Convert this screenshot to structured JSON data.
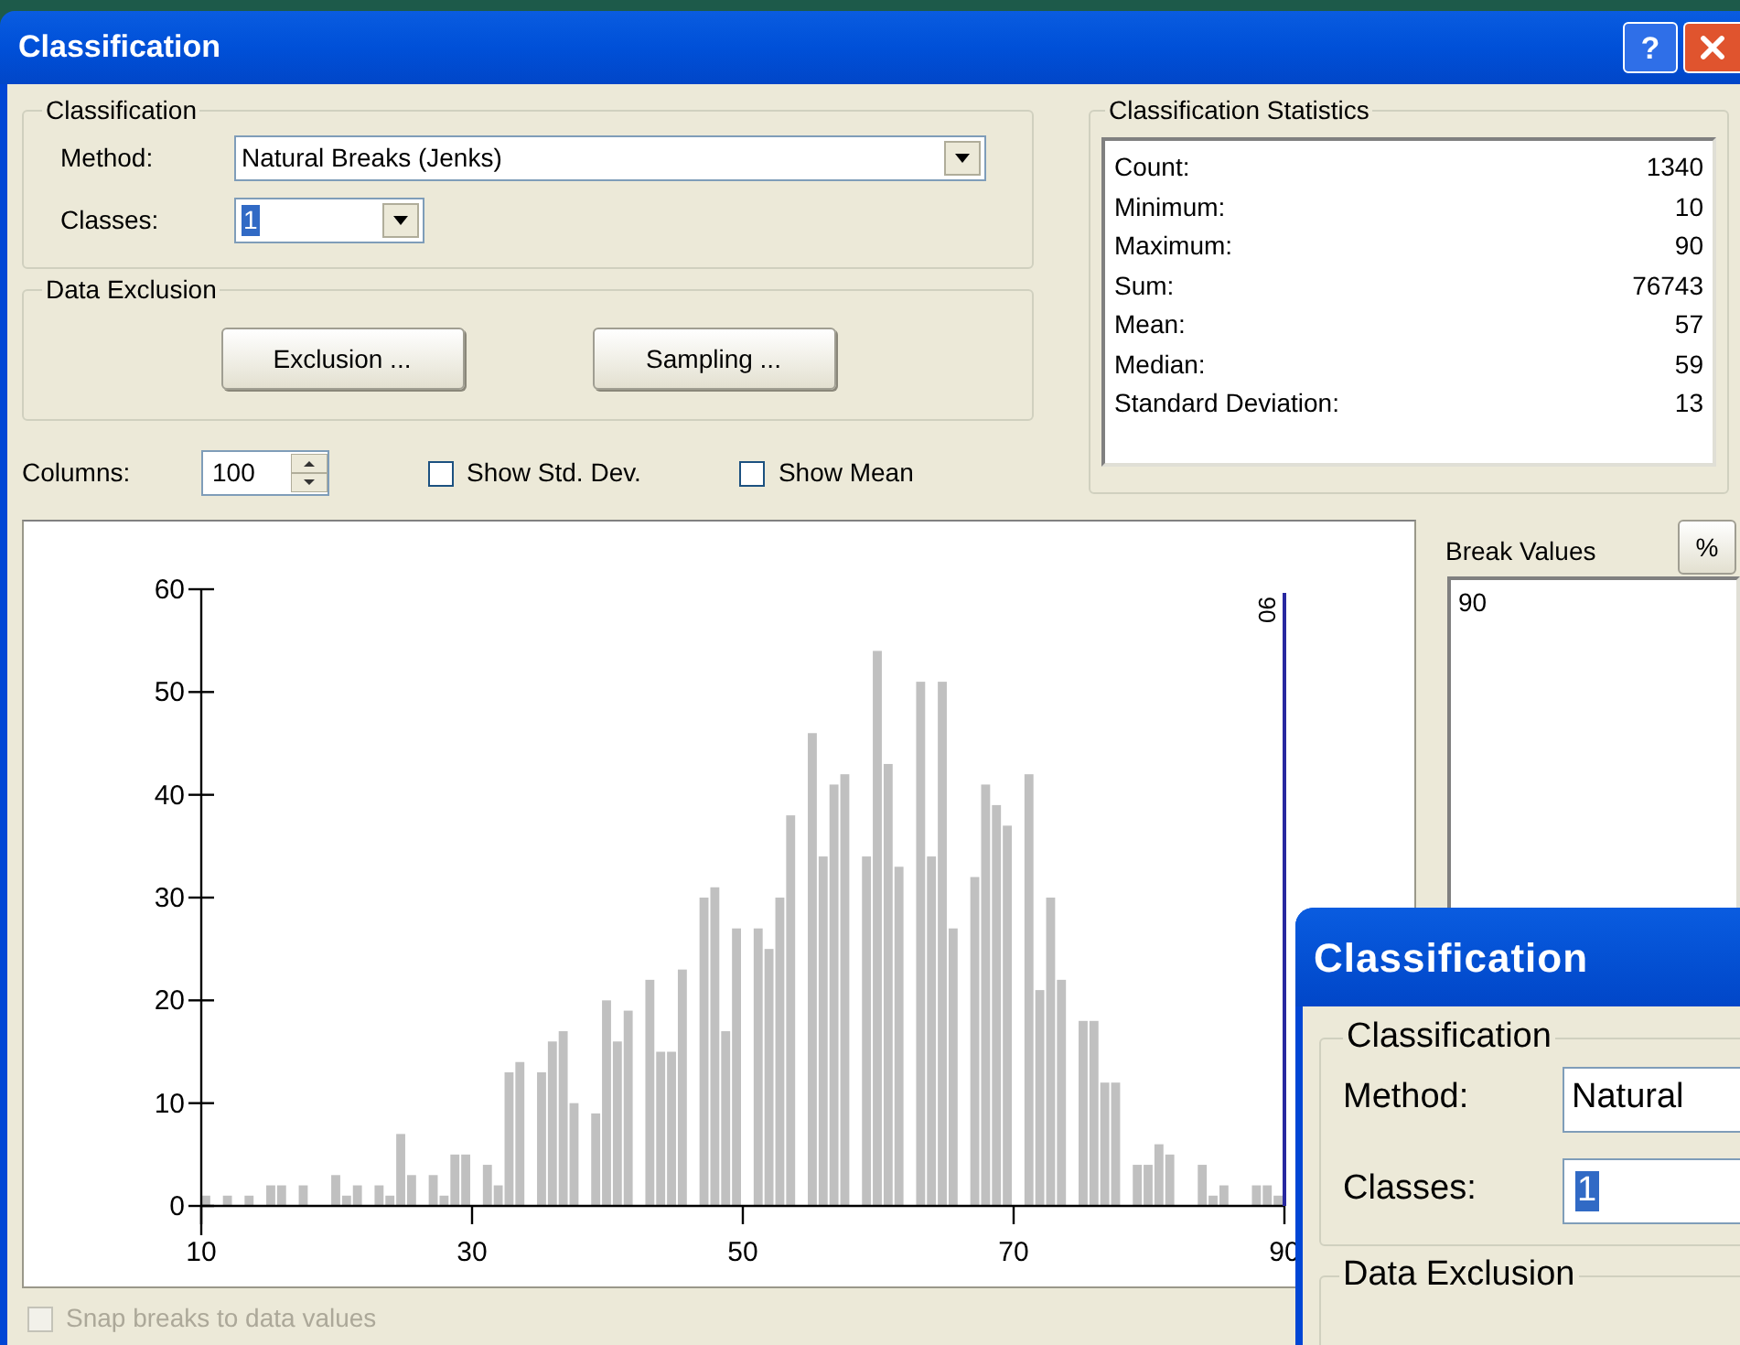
{
  "window": {
    "title": "Classification",
    "help_button": "?"
  },
  "classification": {
    "title": "Classification",
    "method_label": "Method:",
    "method": "Natural Breaks (Jenks)",
    "classes_label": "Classes:",
    "classes": "1"
  },
  "data_exclusion": {
    "title": "Data Exclusion",
    "buttons": [
      "Exclusion ...",
      "Sampling ..."
    ]
  },
  "columns": {
    "label": "Columns:",
    "value": "100"
  },
  "checkboxes": [
    {
      "label": "Show Std. Dev.",
      "checked": false
    },
    {
      "label": "Show Mean",
      "checked": false
    }
  ],
  "statistics": {
    "title": "Classification Statistics",
    "rows": [
      {
        "label": "Count:",
        "value": "1340"
      },
      {
        "label": "Minimum:",
        "value": "10"
      },
      {
        "label": "Maximum:",
        "value": "90"
      },
      {
        "label": "Sum:",
        "value": "76743"
      },
      {
        "label": "Mean:",
        "value": "57"
      },
      {
        "label": "Median:",
        "value": "59"
      },
      {
        "label": "Standard Deviation:",
        "value": "13"
      }
    ]
  },
  "histogram": {
    "chart_data": {
      "type": "bar",
      "xlim": [
        10,
        90
      ],
      "ylim": [
        0,
        60
      ],
      "xticks": [
        10,
        30,
        50,
        70,
        90
      ],
      "yticks": [
        0,
        10,
        20,
        30,
        40,
        50,
        60
      ],
      "x": [
        10.4,
        11.2,
        12,
        12.8,
        13.6,
        14.4,
        15.2,
        16,
        16.8,
        17.6,
        18.4,
        19.2,
        20,
        20.8,
        21.6,
        22.4,
        23.2,
        24,
        24.8,
        25.6,
        26.4,
        27.2,
        28,
        28.8,
        29.6,
        30.4,
        31.2,
        32,
        32.8,
        33.6,
        34.4,
        35.2,
        36,
        36.8,
        37.6,
        38.4,
        39.2,
        40,
        40.8,
        41.6,
        42.4,
        43.2,
        44,
        44.8,
        45.6,
        46.4,
        47.2,
        48,
        48.8,
        49.6,
        50.4,
        51.2,
        52,
        52.8,
        53.6,
        54.4,
        55.2,
        56,
        56.8,
        57.6,
        58.4,
        59.2,
        60,
        60.8,
        61.6,
        62.4,
        63.2,
        64,
        64.8,
        65.6,
        66.4,
        67.2,
        68,
        68.8,
        69.6,
        70.4,
        71.2,
        72,
        72.8,
        73.6,
        74.4,
        75.2,
        76,
        76.8,
        77.6,
        78.4,
        79.2,
        80,
        80.8,
        81.6,
        82.4,
        83.2,
        84,
        84.8,
        85.6,
        86.4,
        87.2,
        88,
        88.8,
        89.6
      ],
      "values": [
        1,
        0,
        1,
        0,
        1,
        0,
        2,
        2,
        0,
        2,
        0,
        0,
        3,
        1,
        2,
        0,
        2,
        1,
        7,
        3,
        0,
        3,
        1,
        5,
        5,
        0,
        4,
        2,
        13,
        14,
        0,
        13,
        16,
        17,
        10,
        0,
        9,
        20,
        16,
        19,
        0,
        22,
        15,
        15,
        23,
        0,
        30,
        31,
        17,
        27,
        0,
        27,
        25,
        30,
        38,
        0,
        46,
        34,
        41,
        42,
        0,
        34,
        54,
        43,
        33,
        0,
        51,
        34,
        51,
        27,
        0,
        32,
        41,
        39,
        37,
        0,
        42,
        21,
        30,
        22,
        0,
        18,
        18,
        12,
        12,
        0,
        4,
        4,
        6,
        5,
        0,
        0,
        4,
        1,
        2,
        0,
        0,
        2,
        2,
        1
      ]
    },
    "break_line": {
      "label": "90"
    }
  },
  "break_values": {
    "label": "Break Values",
    "percent_button": "%",
    "values": [
      "90"
    ]
  },
  "snap": {
    "label": "Snap breaks to data values",
    "checked": false,
    "disabled": true
  },
  "second_dialog": {
    "title": "Classification",
    "group_title": "Classification",
    "method_label": "Method:",
    "method": "Natural",
    "classes_label": "Classes:",
    "classes": "1",
    "exclusion_title": "Data Exclusion"
  }
}
